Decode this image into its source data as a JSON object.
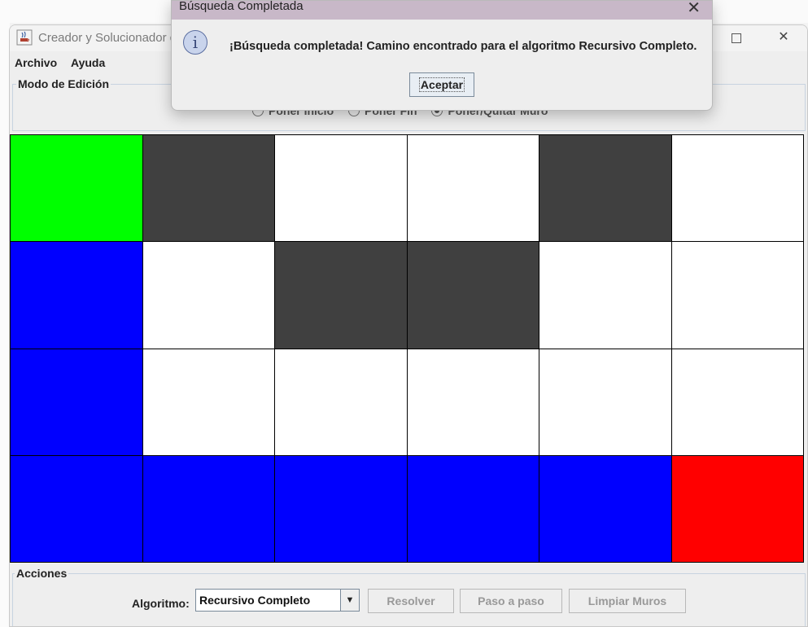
{
  "window": {
    "title": "Creador y Solucionador d",
    "app_icon": "java-cup-icon"
  },
  "menu": [
    "Archivo",
    "Ayuda"
  ],
  "edit_mode": {
    "title": "Modo de Edición",
    "options": [
      {
        "label": "Poner Inicio",
        "selected": false
      },
      {
        "label": "Poner Fin",
        "selected": false
      },
      {
        "label": "Poner/Quitar Muro",
        "selected": true
      }
    ]
  },
  "grid": {
    "rows": 4,
    "cols": 6,
    "colors": {
      "start": "#00ff00",
      "wall": "#404040",
      "empty": "#ffffff",
      "path": "#0000ff",
      "end": "#ff0000"
    },
    "cells": [
      [
        "start",
        "wall",
        "empty",
        "empty",
        "wall",
        "empty"
      ],
      [
        "path",
        "empty",
        "wall",
        "wall",
        "empty",
        "empty"
      ],
      [
        "path",
        "empty",
        "empty",
        "empty",
        "empty",
        "empty"
      ],
      [
        "path",
        "path",
        "path",
        "path",
        "path",
        "end"
      ]
    ]
  },
  "actions": {
    "title": "Acciones",
    "algorithm_label": "Algoritmo:",
    "algorithm_value": "Recursivo Completo",
    "buttons": [
      "Resolver",
      "Paso a paso",
      "Limpiar Muros"
    ]
  },
  "dialog": {
    "title": "Búsqueda Completada",
    "message": "¡Búsqueda completada! Camino encontrado para el algoritmo Recursivo Completo.",
    "ok_label": "Aceptar",
    "icon": "info-icon"
  }
}
